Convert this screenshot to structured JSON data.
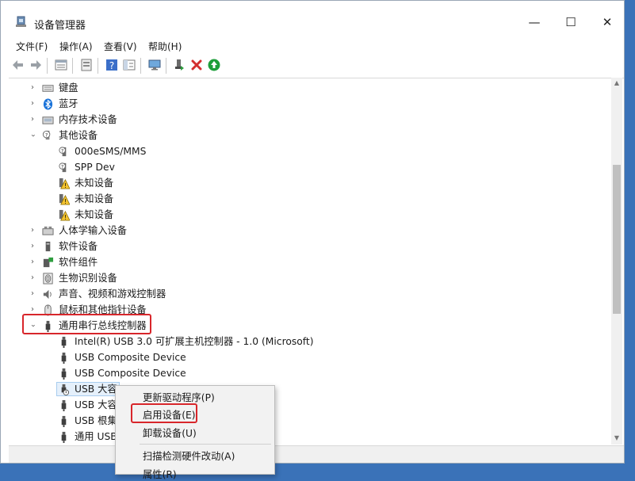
{
  "window": {
    "title": "设备管理器",
    "controls": {
      "minimize": "—",
      "maximize": "☐",
      "close": "✕"
    }
  },
  "menubar": {
    "file": "文件(F)",
    "action": "操作(A)",
    "view": "查看(V)",
    "help": "帮助(H)"
  },
  "tree": {
    "keyboard": "键盘",
    "bluetooth": "蓝牙",
    "memory_tech": "内存技术设备",
    "other_devices": "其他设备",
    "other_children": [
      "000eSMS/MMS",
      "SPP Dev",
      "未知设备",
      "未知设备",
      "未知设备"
    ],
    "hid": "人体学输入设备",
    "software_devices": "软件设备",
    "software_components": "软件组件",
    "biometric": "生物识别设备",
    "sound": "声音、视频和游戏控制器",
    "mouse": "鼠标和其他指针设备",
    "usb_controllers": "通用串行总线控制器",
    "usb_children": [
      "Intel(R) USB 3.0 可扩展主机控制器 - 1.0 (Microsoft)",
      "USB Composite Device",
      "USB Composite Device",
      "USB 大容",
      "USB 大容",
      "USB 根集",
      "通用 USB"
    ]
  },
  "context_menu": {
    "update_driver": "更新驱动程序(P)",
    "enable_device": "启用设备(E)",
    "uninstall_device": "卸载设备(U)",
    "scan_hardware": "扫描检测硬件改动(A)",
    "properties": "属性(R)"
  },
  "colors": {
    "highlight_box": "#d8262b",
    "desktop": "#3a72b8",
    "disable_x": "#d32f2f",
    "enable_arrow": "#1e9e3a"
  }
}
